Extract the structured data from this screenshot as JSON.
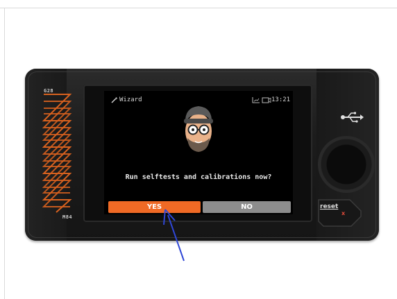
{
  "printer": {
    "left_label": "G28",
    "bottom_label": "M84",
    "reset_label": "reset",
    "reset_mark": "x",
    "usb_icon": "usb-icon",
    "accent_color": "#f06a25"
  },
  "screen": {
    "title": "Wizard",
    "title_icon": "wizard-wand-icon",
    "time": "13:21",
    "status_icons": [
      "chart-icon",
      "camera-icon"
    ],
    "avatar_icon": "bearded-man-avatar-icon",
    "question": "Run selftests and calibrations now?",
    "buttons": {
      "yes": "YES",
      "no": "NO"
    },
    "colors": {
      "yes": "#f06a25",
      "no": "#8d8d8d"
    }
  }
}
